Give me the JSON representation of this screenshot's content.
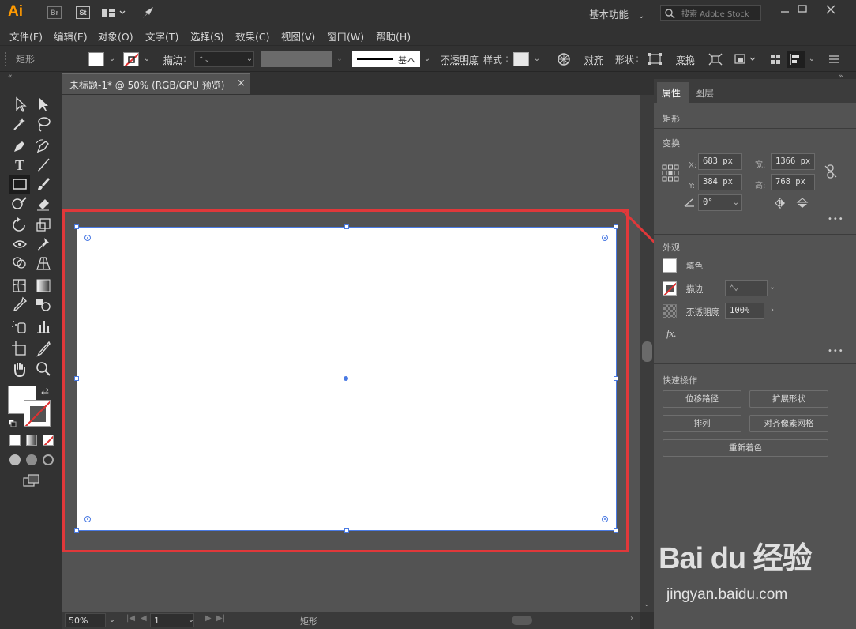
{
  "app": {
    "logo": "Ai",
    "bridge_label": "Br",
    "stock_label": "St",
    "workspace": "基本功能",
    "search_placeholder": "搜索 Adobe Stock"
  },
  "menu": [
    "文件(F)",
    "编辑(E)",
    "对象(O)",
    "文字(T)",
    "选择(S)",
    "效果(C)",
    "视图(V)",
    "窗口(W)",
    "帮助(H)"
  ],
  "control": {
    "object_type": "矩形",
    "stroke_label": "描边",
    "stroke_style": "基本",
    "opacity_label": "不透明度",
    "style_label": "样式",
    "align_label": "对齐",
    "shape_label": "形状",
    "transform_label": "变换"
  },
  "document": {
    "tab_title": "未标题-1* @ 50% (RGB/GPU 预览)",
    "close_glyph": "×"
  },
  "status": {
    "zoom": "50%",
    "page": "1",
    "info": "矩形"
  },
  "panel": {
    "tab_properties": "属性",
    "tab_layers": "图层",
    "object_type": "矩形",
    "transform_title": "变换",
    "x_label": "X:",
    "x_value": "683 px",
    "y_label": "Y:",
    "y_value": "384 px",
    "w_label": "宽:",
    "w_value": "1366 px",
    "h_label": "高:",
    "h_value": "768 px",
    "angle_value": "0°",
    "appearance_title": "外观",
    "fill_label": "填色",
    "stroke_label": "描边",
    "opacity_label": "不透明度",
    "opacity_value": "100%",
    "fx_label": "fx.",
    "quick_actions_title": "快速操作",
    "btn_offset_path": "位移路径",
    "btn_expand_shape": "扩展形状",
    "btn_arrange": "排列",
    "btn_align_pixel": "对齐像素网格",
    "btn_recolor": "重新着色",
    "more": "•••"
  },
  "watermark": {
    "brand": "Bai du 经验",
    "url": "jingyan.baidu.com"
  },
  "colors": {
    "accent_blue": "#4a7ae3",
    "highlight_red": "#e0383a",
    "logo_orange": "#ff9a00"
  }
}
